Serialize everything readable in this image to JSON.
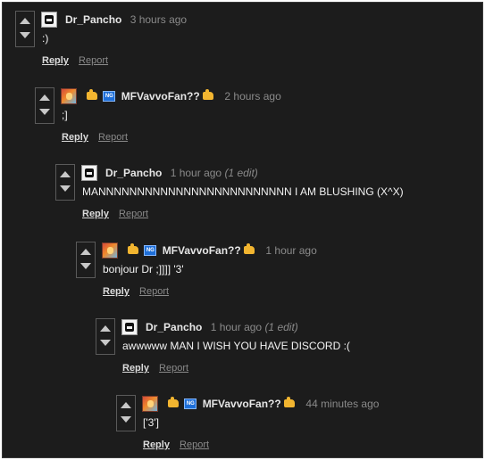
{
  "comments": [
    {
      "username": "Dr_Pancho",
      "timestamp": "3 hours ago",
      "edited": "",
      "body": ":)",
      "reply_label": "Reply",
      "report_label": "Report",
      "avatar": "dr-pancho-avatar",
      "flair_icons": []
    },
    {
      "username": "MFVavvoFan??",
      "timestamp": "2 hours ago",
      "edited": "",
      "body": ";]",
      "reply_label": "Reply",
      "report_label": "Report",
      "avatar": "mfvavvofan-avatar",
      "flair_icons": [
        "hand-icon",
        "ng-icon",
        "hand-icon"
      ]
    },
    {
      "username": "Dr_Pancho",
      "timestamp": "1 hour ago",
      "edited": "(1 edit)",
      "body": "MANNNNNNNNNNNNNNNNNNNNNNNNN I AM BLUSHING (X^X)",
      "reply_label": "Reply",
      "report_label": "Report",
      "avatar": "dr-pancho-avatar",
      "flair_icons": []
    },
    {
      "username": "MFVavvoFan??",
      "timestamp": "1 hour ago",
      "edited": "",
      "body": "bonjour Dr ;]]]] '3'",
      "reply_label": "Reply",
      "report_label": "Report",
      "avatar": "mfvavvofan-avatar",
      "flair_icons": [
        "hand-icon",
        "ng-icon",
        "hand-icon"
      ]
    },
    {
      "username": "Dr_Pancho",
      "timestamp": "1 hour ago",
      "edited": "(1 edit)",
      "body": "awwwww MAN I WISH YOU HAVE DISCORD :(",
      "reply_label": "Reply",
      "report_label": "Report",
      "avatar": "dr-pancho-avatar",
      "flair_icons": []
    },
    {
      "username": "MFVavvoFan??",
      "timestamp": "44 minutes ago",
      "edited": "",
      "body": "['3']",
      "reply_label": "Reply",
      "report_label": "Report",
      "avatar": "mfvavvofan-avatar",
      "flair_icons": [
        "hand-icon",
        "ng-icon",
        "hand-icon"
      ]
    }
  ],
  "badge_text": {
    "ng": "NG"
  },
  "colors": {
    "background": "#1c1c1c",
    "text": "#f2f2f2",
    "muted": "#8a8a8a",
    "hand_icon": "#f2b530",
    "ng_icon": "#1e6fd9"
  }
}
